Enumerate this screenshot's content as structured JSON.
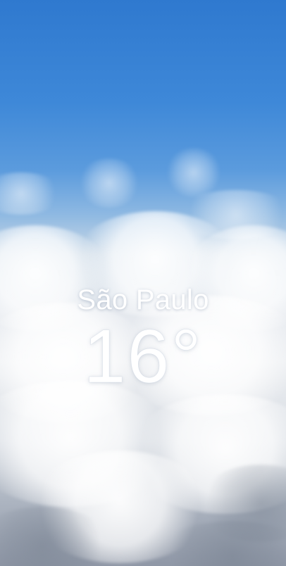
{
  "weather": {
    "location": "São Paulo",
    "temperature": "16°"
  }
}
